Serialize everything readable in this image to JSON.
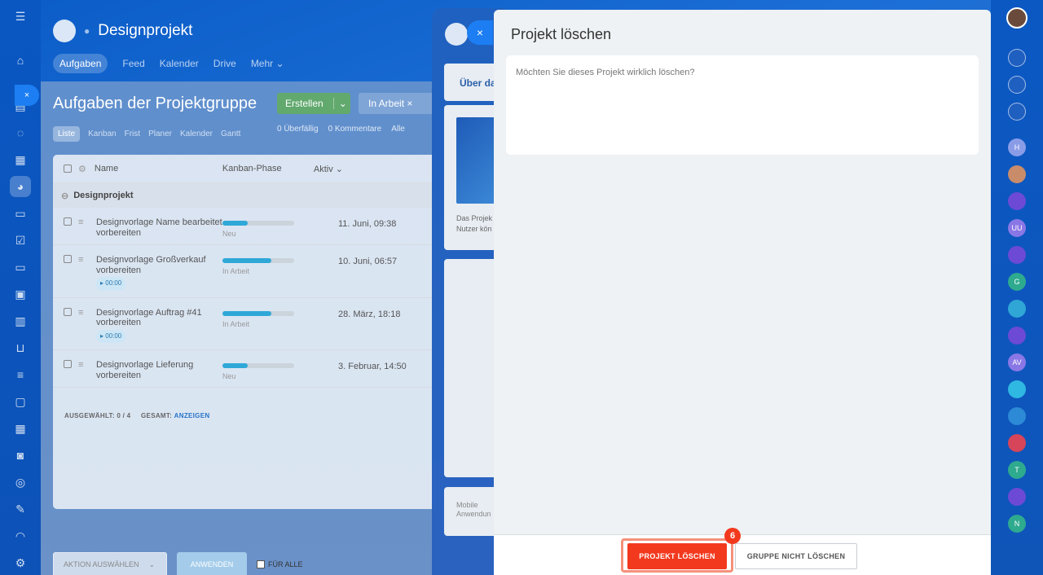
{
  "left_rail": {
    "icons": [
      "menu-icon",
      "home-icon",
      "feed-icon",
      "chat-icon",
      "calendar-icon",
      "groups-icon",
      "documents-icon",
      "tasks-icon",
      "drive-icon",
      "board-icon",
      "analytics-icon",
      "shop-icon",
      "filter-icon",
      "crm-icon",
      "schedule-icon",
      "robot-icon",
      "target-icon",
      "sign-icon",
      "support-icon",
      "settings-icon"
    ]
  },
  "bg_window": {
    "title": "Designprojekt",
    "tabs": [
      "Aufgaben",
      "Feed",
      "Kalender",
      "Drive",
      "Mehr ⌄"
    ],
    "page_title": "Aufgaben der Projektgruppe",
    "create_label": "Erstellen",
    "filter_label": "In Arbeit",
    "views": [
      "Liste",
      "Kanban",
      "Frist",
      "Planer",
      "Kalender",
      "Gantt"
    ],
    "counters": [
      "0 Überfällig",
      "0 Kommentare",
      "Alle"
    ],
    "table": {
      "headers": [
        "Name",
        "Kanban-Phase",
        "Aktiv ⌄"
      ],
      "group": "Designprojekt",
      "rows": [
        {
          "name": "Designvorlage Name bearbeitet vorbereiten",
          "phase": "Neu",
          "progress": 0.35,
          "date": "11. Juni, 09:38",
          "timer": ""
        },
        {
          "name": "Designvorlage Großverkauf vorbereiten",
          "phase": "In Arbeit",
          "progress": 0.68,
          "date": "10. Juni, 06:57",
          "timer": "▸ 00:00"
        },
        {
          "name": "Designvorlage Auftrag #41 vorbereiten",
          "phase": "In Arbeit",
          "progress": 0.68,
          "date": "28. März, 18:18",
          "timer": "▸ 00:00"
        },
        {
          "name": "Designvorlage Lieferung vorbereiten",
          "phase": "Neu",
          "progress": 0.35,
          "date": "3. Februar, 14:50",
          "timer": ""
        }
      ],
      "selected": "AUSGEWÄHLT: 0 / 4",
      "total": "GESAMT:",
      "total_link": "ANZEIGEN"
    },
    "action_select": "AKTION AUSWÄHLEN",
    "apply_label": "ANWENDEN",
    "for_all_label": "FÜR ALLE"
  },
  "mid_panel": {
    "tab": "Über da",
    "desc": "Das Projek Nutzer kön",
    "mobile": "Mobile Anwendun"
  },
  "slider": {
    "title": "Projekt löschen",
    "question": "Möchten Sie dieses Projekt wirklich löschen?",
    "delete_label": "PROJEKT LÖSCHEN",
    "keep_label": "GRUPPE NICHT LÖSCHEN",
    "step_badge": "6"
  },
  "right_rail": {
    "items": [
      {
        "icon": "bell-icon",
        "text": "",
        "color": "#1e5fc0"
      },
      {
        "icon": "spiral-icon",
        "text": "",
        "color": "#1e5fc0"
      },
      {
        "icon": "chat-search-icon",
        "text": "",
        "color": "#1e5fc0"
      },
      {
        "icon": "avatar",
        "text": "H",
        "color": "#8a9ce8"
      },
      {
        "icon": "avatar",
        "text": "",
        "color": "#c88c6a"
      },
      {
        "icon": "spiral-icon",
        "text": "",
        "color": "#6c4ad6"
      },
      {
        "icon": "avatar",
        "text": "UU",
        "color": "#8a77e6"
      },
      {
        "icon": "spiral-icon",
        "text": "",
        "color": "#6c4ad6"
      },
      {
        "icon": "avatar",
        "text": "G",
        "color": "#2eaa8e"
      },
      {
        "icon": "lock-icon",
        "text": "",
        "color": "#2fa6d6"
      },
      {
        "icon": "spiral-icon",
        "text": "",
        "color": "#6c4ad6"
      },
      {
        "icon": "avatar",
        "text": "AV",
        "color": "#8a77e6"
      },
      {
        "icon": "chat-icon",
        "text": "",
        "color": "#2fb8e2"
      },
      {
        "icon": "card-icon",
        "text": "",
        "color": "#2d8ad6"
      },
      {
        "icon": "lock-icon",
        "text": "",
        "color": "#d6455a"
      },
      {
        "icon": "avatar",
        "text": "T",
        "color": "#2eaa8e"
      },
      {
        "icon": "task-icon",
        "text": "",
        "color": "#6c4ad6"
      },
      {
        "icon": "avatar",
        "text": "N",
        "color": "#2eaa8e"
      }
    ]
  }
}
